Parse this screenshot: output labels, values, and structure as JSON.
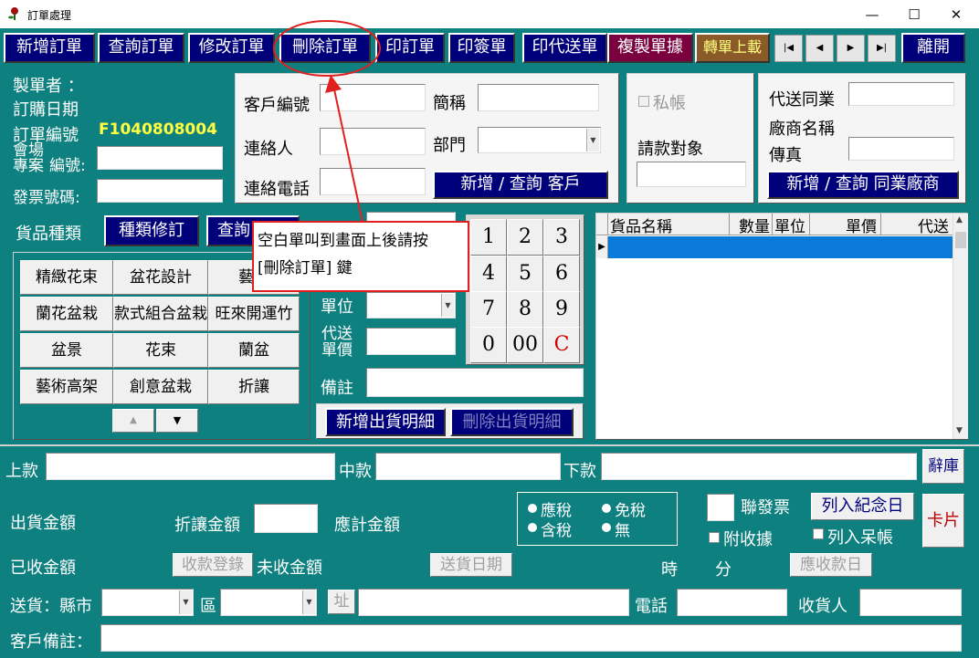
{
  "window": {
    "title": "訂單處理",
    "minimize": "—",
    "maximize": "☐",
    "close": "✕"
  },
  "toolbar": {
    "new_order": "新增訂單",
    "query_order": "查詢訂單",
    "modify_order": "修改訂單",
    "delete_order": "刪除訂單",
    "print_order": "印訂單",
    "print_sign": "印簽單",
    "print_delivery": "印代送單",
    "copy_document": "複製單據",
    "transfer_upload": "轉單上載",
    "nav_first": "|◀",
    "nav_prev": "◀",
    "nav_next": "▶",
    "nav_last": "▶|",
    "leave": "離開"
  },
  "order_info": {
    "maker_label": "製單者 ：",
    "order_date_label": "訂購日期",
    "order_no_label": "訂單編號",
    "order_no_value": "F1040808004",
    "venue_label_1": "會場",
    "venue_label_2": "專案",
    "venue_label_3": "編號:",
    "invoice_label": "發票號碼:"
  },
  "customer": {
    "code_label": "客戶編號",
    "short_name_label": "簡稱",
    "contact_label": "連絡人",
    "dept_label": "部門",
    "phone_label": "連絡電話",
    "add_query_button": "新增 / 查詢  客戶"
  },
  "billing": {
    "private_account_label": "私帳",
    "billing_target_label": "請款對象"
  },
  "peer": {
    "proxy_peer_label": "代送同業",
    "vendor_name_label": "廠商名稱",
    "fax_label": "傳真",
    "add_query_button": "新增 / 查詢  同業廠商"
  },
  "goods": {
    "category_label": "貨品種類",
    "category_edit_button": "種類修訂",
    "query_button": "查詢",
    "categories": [
      "精緻花束",
      "盆花設計",
      "藝術",
      "蘭花盆栽",
      "款式組合盆栽",
      "旺來開運竹",
      "盆景",
      "花束",
      "蘭盆",
      "藝術高架",
      "創意盆栽",
      "折讓"
    ],
    "scroll_up": "▲",
    "scroll_down": "▼",
    "unit_label": "單位",
    "proxy_price_label_1": "代送",
    "proxy_price_label_2": "單價",
    "remark_label": "備註",
    "add_detail_button": "新增出貨明細",
    "delete_detail_button": "刪除出貨明細"
  },
  "keypad": [
    "1",
    "2",
    "3",
    "4",
    "5",
    "6",
    "7",
    "8",
    "9",
    "0",
    "00",
    "C"
  ],
  "grid": {
    "columns": [
      "貨品名稱",
      "數量",
      "單位",
      "單價",
      "代送"
    ],
    "row_marker": "▶"
  },
  "annotation": {
    "line1": "空白單叫到畫面上後請按",
    "line2": "[刪除訂單] 鍵"
  },
  "bottom": {
    "upper_label": "上款",
    "middle_label": "中款",
    "lower_label": "下款",
    "phrase_button": "辭庫",
    "ship_amount_label": "出貨金額",
    "discount_label": "折讓金額",
    "payable_label": "應計金額",
    "tax_options": [
      "應稅",
      "免稅",
      "含稅",
      "無"
    ],
    "linked_invoice_label": "聯發票",
    "souvenir_button": "列入紀念日",
    "card_button": "卡片",
    "receipt_label": "附收據",
    "bad_debt_label": "列入呆帳",
    "received_label": "已收金額",
    "payment_register_button": "收款登錄",
    "unreceived_label": "未收金額",
    "delivery_date_button": "送貨日期",
    "hour_label": "時",
    "minute_label": "分",
    "due_date_button": "應收款日",
    "delivery_city_label": "送貨：縣市",
    "district_label": "區",
    "address_button": "址",
    "phone_label": "電話",
    "receiver_label": "收貨人",
    "customer_remark_label": "客戶備註："
  }
}
